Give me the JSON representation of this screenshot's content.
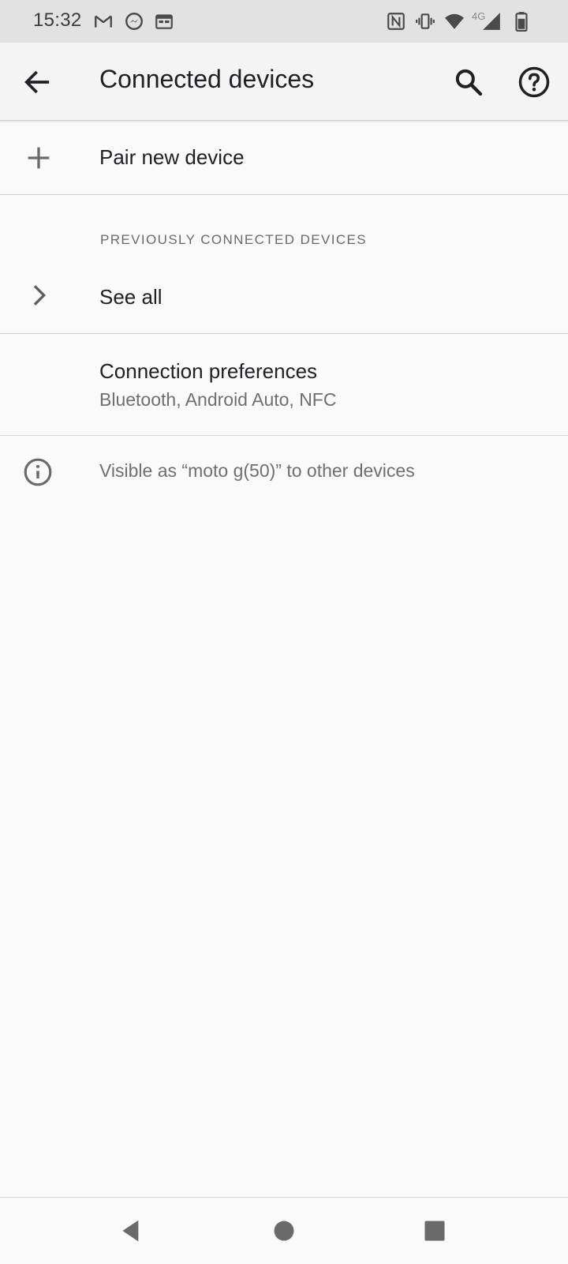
{
  "status_bar": {
    "time": "15:32",
    "left_icons": [
      "gmail-icon",
      "messenger-icon",
      "calendar-icon"
    ],
    "right_icons": [
      "nfc-icon",
      "vibrate-icon",
      "wifi-icon",
      "4g-signal-icon",
      "battery-icon"
    ],
    "network_label": "4G"
  },
  "app_bar": {
    "title": "Connected devices",
    "back_icon": "arrow-back-icon",
    "search_icon": "search-icon",
    "help_icon": "help-icon"
  },
  "items": {
    "pair_new_device": {
      "label": "Pair new device",
      "icon": "plus-icon"
    },
    "previously_connected": {
      "header": "PREVIOUSLY CONNECTED DEVICES",
      "see_all_label": "See all",
      "icon": "chevron-right-icon"
    },
    "connection_preferences": {
      "title": "Connection preferences",
      "summary": "Bluetooth, Android Auto, NFC"
    },
    "footer_info": {
      "text": "Visible as “moto g(50)” to other devices",
      "icon": "info-icon"
    }
  },
  "nav_bar": {
    "buttons": [
      "back-triangle-icon",
      "home-circle-icon",
      "recents-square-icon"
    ]
  },
  "colors": {
    "status_bar_bg": "#e2e2e2",
    "app_bar_bg": "#f4f4f4",
    "page_bg": "#fafafa",
    "primary_text": "#202124",
    "secondary_text": "#6f6f6f"
  }
}
